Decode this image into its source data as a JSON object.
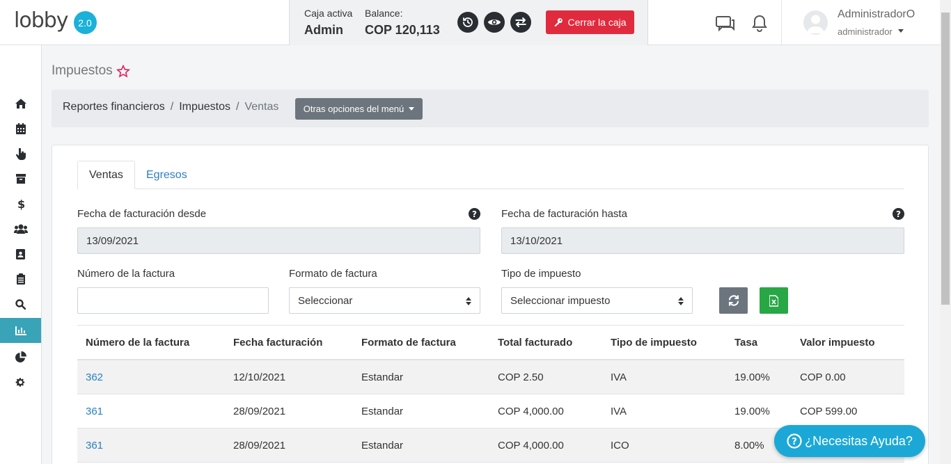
{
  "app": {
    "logo_text": "lobby",
    "version_badge": "2.0"
  },
  "cash": {
    "active_label": "Caja activa",
    "active_value": "Admin",
    "balance_label": "Balance:",
    "balance_value": "COP 120,113",
    "close_label": "Cerrar la caja"
  },
  "user": {
    "name": "AdministradorO",
    "role": "administrador"
  },
  "page": {
    "title": "Impuestos"
  },
  "breadcrumb": {
    "items": [
      "Reportes financieros",
      "Impuestos",
      "Ventas"
    ],
    "separator": "/",
    "menu_button": "Otras opciones del menú"
  },
  "tabs": [
    {
      "label": "Ventas",
      "active": true
    },
    {
      "label": "Egresos",
      "active": false
    }
  ],
  "filters": {
    "date_from_label": "Fecha de facturación desde",
    "date_from_value": "13/09/2021",
    "date_to_label": "Fecha de facturación hasta",
    "date_to_value": "13/10/2021",
    "invoice_number_label": "Número de la factura",
    "invoice_number_value": "",
    "format_label": "Formato de factura",
    "format_value": "Seleccionar",
    "tax_type_label": "Tipo de impuesto",
    "tax_type_value": "Seleccionar impuesto"
  },
  "table": {
    "headers": [
      "Número de la factura",
      "Fecha facturación",
      "Formato de factura",
      "Total facturado",
      "Tipo de impuesto",
      "Tasa",
      "Valor impuesto"
    ],
    "rows": [
      [
        "362",
        "12/10/2021",
        "Estandar",
        "COP 2.50",
        "IVA",
        "19.00%",
        "COP 0.00"
      ],
      [
        "361",
        "28/09/2021",
        "Estandar",
        "COP 4,000.00",
        "IVA",
        "19.00%",
        "COP 599.00"
      ],
      [
        "361",
        "28/09/2021",
        "Estandar",
        "COP 4,000.00",
        "ICO",
        "8.00%",
        ""
      ]
    ]
  },
  "help_button": "¿Necesitas Ayuda?",
  "colors": {
    "accent": "#1bb1d8",
    "sidebar_active": "#39a3b8",
    "danger": "#e02a3d",
    "success": "#28a745",
    "link": "#2a7fc1"
  },
  "sidebar_icons": [
    "home-icon",
    "calendar-icon",
    "hand-pointer-icon",
    "archive-icon",
    "dollar-icon",
    "users-icon",
    "address-book-icon",
    "clipboard-icon",
    "search-icon",
    "chart-bar-icon",
    "pie-chart-icon",
    "gear-icon"
  ],
  "sidebar_active_index": 9
}
